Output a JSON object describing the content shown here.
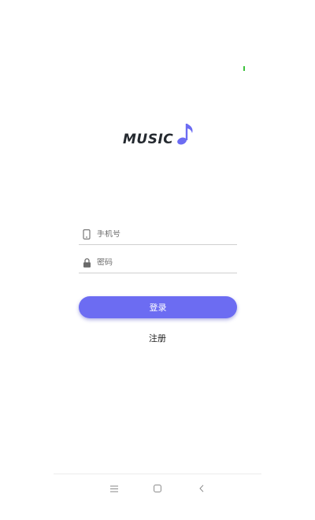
{
  "app": {
    "logo_text": "MUSIC"
  },
  "status": {
    "indicator_color": "#3cc23c"
  },
  "login_form": {
    "phone_placeholder": "手机号",
    "phone_icon": "phone-icon",
    "password_placeholder": "密码",
    "password_icon": "lock-icon",
    "login_label": "登录",
    "register_label": "注册"
  },
  "nav_bar": {
    "buttons": [
      "menu-icon",
      "home-icon",
      "back-icon"
    ]
  },
  "colors": {
    "accent": "#6c6cf2",
    "logo_note": "#6c6cf2",
    "logo_text": "#24292f"
  }
}
